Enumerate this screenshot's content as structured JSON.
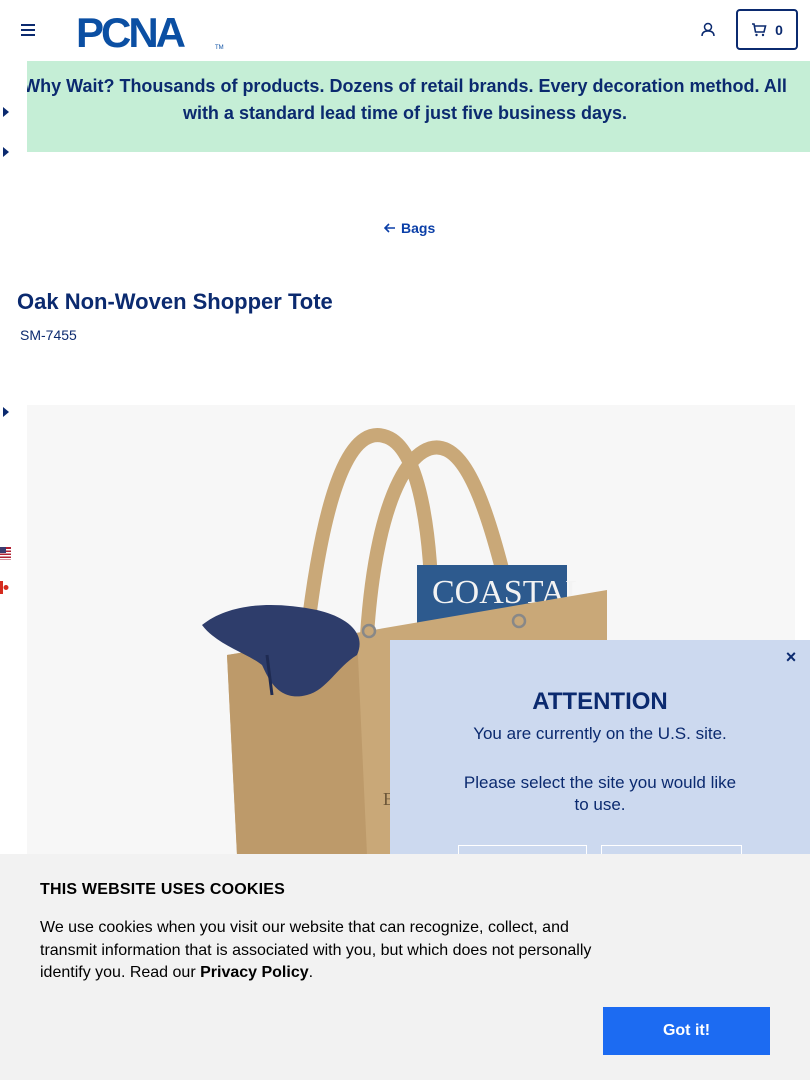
{
  "header": {
    "logo_text": "PCNA",
    "logo_tm": "TM",
    "cart_count": "0"
  },
  "banner": {
    "text": "Why Wait? Thousands of products. Dozens of retail brands. Every decoration method. All with a standard lead time of just five business days."
  },
  "breadcrumb": {
    "back_label": "Bags"
  },
  "product": {
    "title": "Oak Non-Woven Shopper Tote",
    "sku": "SM-7455",
    "image_magazine_text": "COASTAL",
    "image_bag_letter": "E"
  },
  "attention_modal": {
    "close_label": "×",
    "title": "ATTENTION",
    "message": "You are currently on the U.S. site.",
    "prompt": "Please select the site you would like to use."
  },
  "cookie_bar": {
    "title": "THIS WEBSITE USES COOKIES",
    "text_before": "We use cookies when you visit our website that can recognize, collect, and transmit information that is associated with you, but which does not personally identify you. Read our ",
    "privacy_link": "Privacy Policy",
    "text_after": ".",
    "button_label": "Got it!"
  },
  "colors": {
    "brand_navy": "#0b2a6f",
    "banner_bg": "#c5eed6",
    "modal_bg": "#ccd9ef",
    "cookie_button": "#1c6bf2"
  }
}
